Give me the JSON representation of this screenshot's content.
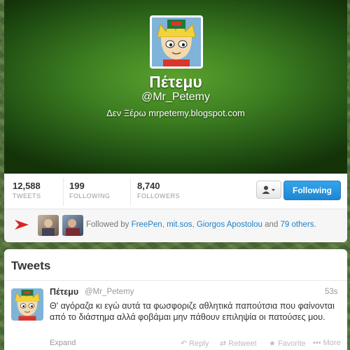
{
  "profile": {
    "name": "Πέτεμυ",
    "handle": "@Mr_Petemy",
    "bio": "Δεν Ξέρω mrpetemy.blogspot.com"
  },
  "stats": [
    {
      "value": "12,588",
      "label": "TWEETS"
    },
    {
      "value": "199",
      "label": "FOLLOWING"
    },
    {
      "value": "8,740",
      "label": "FOLLOWERS"
    }
  ],
  "actions": {
    "user_menu_icon": "person-dropdown-icon",
    "follow_label": "Following"
  },
  "followed_by": {
    "prefix": "Followed by",
    "names": [
      "FreePen",
      "mit.sos",
      "Giorgos Apostolou"
    ],
    "sep1": ",",
    "sep2": ",",
    "and": "and",
    "others": "79 others."
  },
  "tweets": {
    "title": "Tweets",
    "items": [
      {
        "name": "Πέτεμυ",
        "handle": "@Mr_Petemy",
        "time": "53s",
        "text": "Θ' αγόραζα κι εγώ αυτά τα φωσφοριζε αθλητικά παπούτσια που φαίνονται από το διάστημα αλλά φοβάμαι μην πάθουν επιληψία οι πατούσες μου.",
        "expand": "Expand",
        "reply": "Reply",
        "retweet": "Retweet",
        "favorite": "Favorite",
        "more": "More"
      }
    ]
  },
  "colors": {
    "accent": "#1f86d0",
    "header_green": "#3d7e21",
    "link": "#1f7fc4"
  }
}
